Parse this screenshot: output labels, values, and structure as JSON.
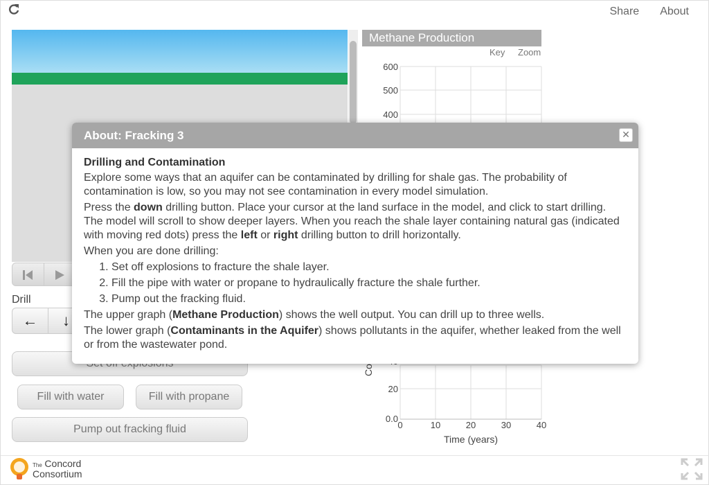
{
  "top": {
    "links": [
      "Share",
      "About"
    ]
  },
  "model": {
    "drill_label": "Drill",
    "drill_buttons": [
      "←",
      "↓"
    ],
    "explosions_label": "Set off explosions",
    "fill_water_label": "Fill with water",
    "fill_propane_label": "Fill with propane",
    "pump_label": "Pump out fracking fluid"
  },
  "chart": {
    "title": "Methane Production",
    "key_label": "Key",
    "zoom_label": "Zoom",
    "upper_y_ticks": [
      "600",
      "500",
      "400"
    ],
    "lower_y_ticks": [
      "20",
      "0.0"
    ],
    "lower_partial_tick": "40",
    "lower_ylabel_visible": "Co",
    "x_ticks": [
      "0",
      "10",
      "20",
      "30",
      "40"
    ],
    "xlabel": "Time (years)"
  },
  "chart_data": [
    {
      "type": "line",
      "title": "Methane Production",
      "ylim": [
        0,
        600
      ],
      "y_ticks": [
        400,
        500,
        600
      ],
      "series": []
    },
    {
      "type": "line",
      "title": "Contaminants in the Aquifer",
      "xlabel": "Time (years)",
      "xlim": [
        0,
        40
      ],
      "x_ticks": [
        0,
        10,
        20,
        30,
        40
      ],
      "y_ticks": [
        0.0,
        20,
        40
      ],
      "series": []
    }
  ],
  "dialog": {
    "title": "About: Fracking 3",
    "close_glyph": "✕",
    "heading": "Drilling and Contamination",
    "p1": "Explore some ways that an aquifer can be contaminated by drilling for shale gas. The probability of contamination is low, so you may not see contamination in every model simulation.",
    "p2_a": "Press the ",
    "p2_b": "down",
    "p2_c": " drilling button. Place your cursor at the land surface in the model, and click to start drilling. The model will scroll to show deeper layers. When you reach the shale layer containing natural gas (indicated with moving red dots) press the ",
    "p2_d": "left",
    "p2_e": " or ",
    "p2_f": "right",
    "p2_g": " drilling button to drill horizontally.",
    "p3": "When you are done drilling:",
    "steps": [
      "Set off explosions to fracture the shale layer.",
      "Fill the pipe with water or propane to hydraulically fracture the shale further.",
      "Pump out the fracking fluid."
    ],
    "p4_a": "The upper graph (",
    "p4_b": "Methane Production",
    "p4_c": ") shows the well output. You can drill up to three wells.",
    "p5_a": "The lower graph (",
    "p5_b": "Contaminants in the Aquifer",
    "p5_c": ") shows pollutants in the aquifer, whether leaked from the well or from the wastewater pond."
  },
  "footer": {
    "logo_small": "The",
    "logo_line1": "Concord",
    "logo_line2": "Consortium"
  }
}
